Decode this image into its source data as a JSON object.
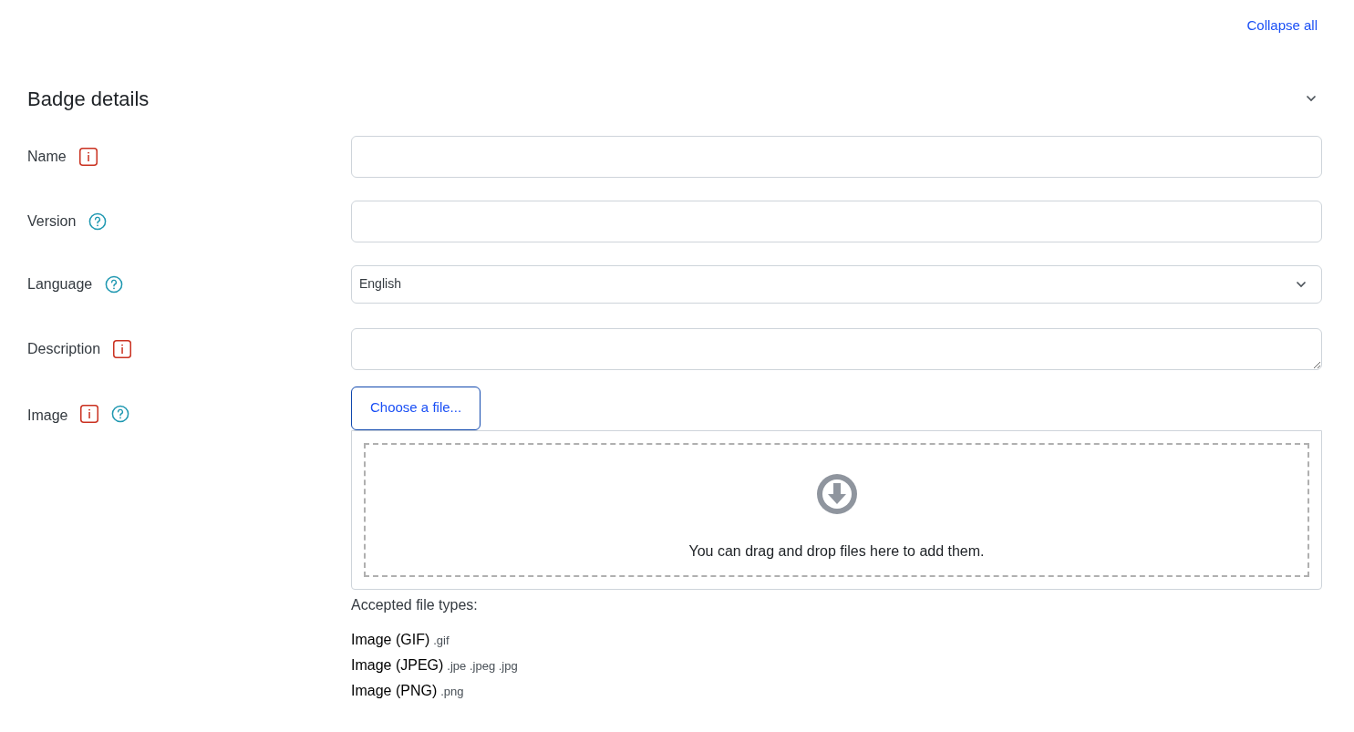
{
  "collapse_all": "Collapse all",
  "section": {
    "title": "Badge details",
    "expanded": true
  },
  "fields": [
    {
      "kind": "text",
      "label": "Name",
      "required": true,
      "help": false
    },
    {
      "kind": "text",
      "label": "Version",
      "required": false,
      "help": true
    },
    {
      "kind": "select",
      "label": "Language",
      "required": false,
      "help": true,
      "value": "English"
    },
    {
      "kind": "textarea",
      "label": "Description",
      "required": true,
      "help": false
    },
    {
      "kind": "file",
      "label": "Image",
      "required": true,
      "help": true,
      "button": "Choose a file...",
      "drop_text": "You can drag and drop files here to add them.",
      "accepted_label": "Accepted file types:",
      "types": [
        {
          "name": "Image (GIF)",
          "extensions": ".gif"
        },
        {
          "name": "Image (JPEG)",
          "extensions": ".jpe .jpeg .jpg"
        },
        {
          "name": "Image (PNG)",
          "extensions": ".png"
        }
      ]
    }
  ]
}
